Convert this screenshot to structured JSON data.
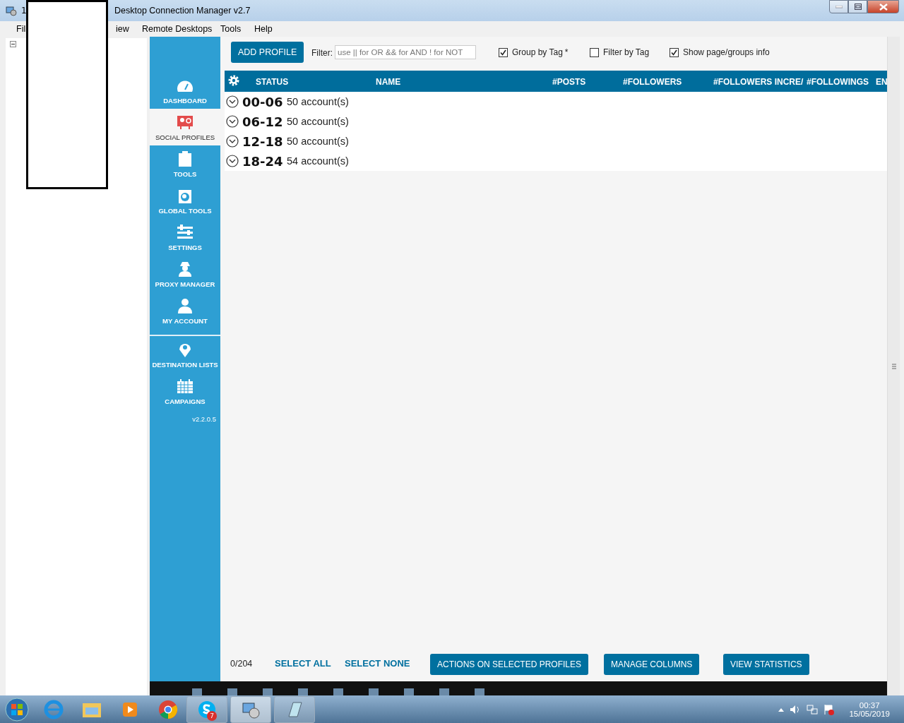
{
  "window": {
    "title_prefix": "1",
    "title": "Desktop Connection Manager v2.7"
  },
  "menu": [
    {
      "label": "Fil"
    },
    {
      "label": "iew"
    },
    {
      "label": "Remote Desktops"
    },
    {
      "label": "Tools"
    },
    {
      "label": "Help"
    }
  ],
  "sidebar": {
    "sections": [
      {
        "items": [
          {
            "label": "DASHBOARD",
            "selected": false
          },
          {
            "label": "SOCIAL PROFILES",
            "selected": true
          },
          {
            "label": "TOOLS",
            "selected": false
          },
          {
            "label": "GLOBAL TOOLS",
            "selected": false
          },
          {
            "label": "SETTINGS",
            "selected": false
          },
          {
            "label": "PROXY MANAGER",
            "selected": false
          },
          {
            "label": "MY ACCOUNT",
            "selected": false
          }
        ]
      },
      {
        "items": [
          {
            "label": "DESTINATION LISTS",
            "selected": false
          },
          {
            "label": "CAMPAIGNS",
            "selected": false
          }
        ]
      }
    ],
    "version": "v2.2.0.5"
  },
  "toolbar": {
    "add_button": "ADD PROFILE",
    "filter_label": "Filter:",
    "filter_placeholder": "use || for OR && for AND ! for NOT",
    "checkboxes": [
      {
        "label": "Group by Tag",
        "suffix": "*",
        "checked": true
      },
      {
        "label": "Filter by Tag",
        "checked": false
      },
      {
        "label": "Show page/groups info",
        "checked": true
      }
    ]
  },
  "table": {
    "columns": [
      "STATUS",
      "NAME",
      "#POSTS",
      "#FOLLOWERS",
      "#FOLLOWERS INCRE/",
      "#FOLLOWINGS",
      "EN"
    ],
    "groups": [
      {
        "name": "00-06",
        "count": "50 account(s)",
        "expanded": false
      },
      {
        "name": "06-12",
        "count": "50 account(s)",
        "expanded": false
      },
      {
        "name": "12-18",
        "count": "50 account(s)",
        "expanded": false
      },
      {
        "name": "18-24",
        "count": "54 account(s)",
        "expanded": false
      }
    ]
  },
  "footer": {
    "selection": "0/204",
    "links": [
      "SELECT ALL",
      "SELECT NONE"
    ],
    "buttons": [
      "ACTIONS ON SELECTED PROFILES",
      "MANAGE COLUMNS",
      "VIEW STATISTICS"
    ]
  },
  "taskbar": {
    "skype_badge": "7",
    "time": "00:37",
    "date": "15/05/2019"
  }
}
